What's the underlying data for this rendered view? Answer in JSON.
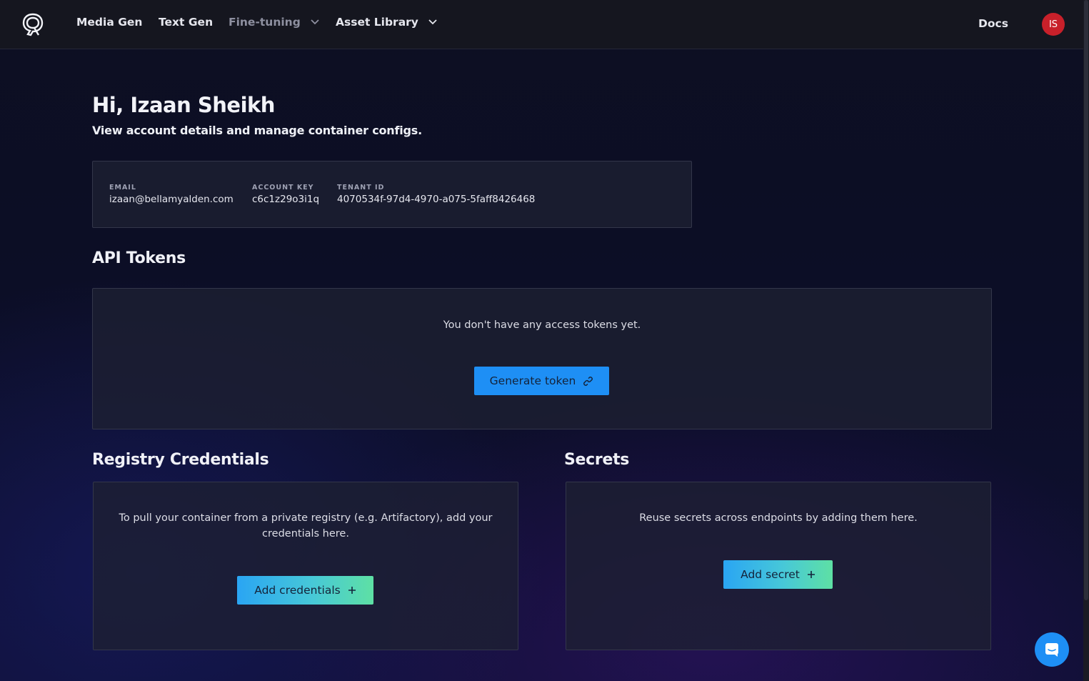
{
  "nav": {
    "items": [
      {
        "label": "Media Gen",
        "dropdown": false,
        "muted": false
      },
      {
        "label": "Text Gen",
        "dropdown": false,
        "muted": false
      },
      {
        "label": "Fine-tuning",
        "dropdown": true,
        "muted": true
      },
      {
        "label": "Asset Library",
        "dropdown": true,
        "muted": false
      }
    ],
    "docs_label": "Docs",
    "avatar_initials": "IS",
    "avatar_color": "#c8202a"
  },
  "header": {
    "greeting": "Hi, Izaan Sheikh",
    "subtitle": "View account details and manage container configs."
  },
  "account": {
    "email_label": "EMAIL",
    "email": "izaan@bellamyalden.com",
    "account_key_label": "ACCOUNT KEY",
    "account_key": "c6c1z29o3i1q",
    "tenant_id_label": "TENANT ID",
    "tenant_id": "4070534f-97d4-4970-a075-5faff8426468"
  },
  "api_tokens": {
    "title": "API Tokens",
    "empty_text": "You don't have any access tokens yet.",
    "button_label": "Generate token",
    "button_icon": "link-icon"
  },
  "registry": {
    "title": "Registry Credentials",
    "empty_text_line1": "To pull your container from a private registry (e.g. Artifactory), add your",
    "empty_text_line2": "credentials here.",
    "button_label": "Add credentials",
    "button_icon": "plus-icon"
  },
  "secrets": {
    "title": "Secrets",
    "empty_text": "Reuse secrets across endpoints by adding them here.",
    "button_label": "Add secret",
    "button_icon": "plus-icon"
  },
  "colors": {
    "accent": "#1e8ff5",
    "gradient_start": "#2aa5f3",
    "gradient_end": "#5ee0a4"
  }
}
